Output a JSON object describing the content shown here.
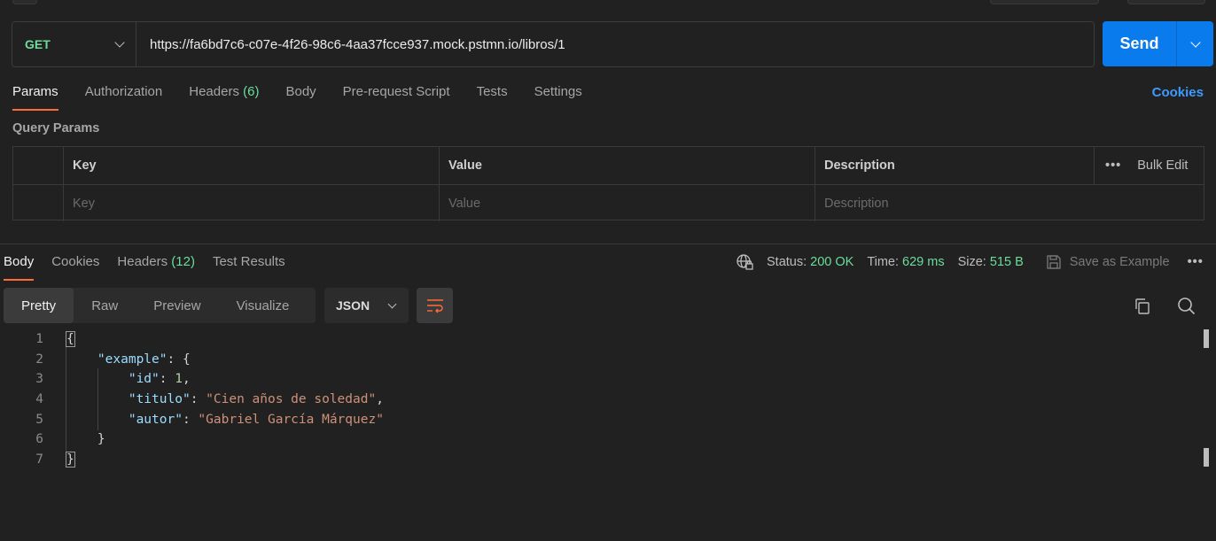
{
  "request": {
    "method": "GET",
    "url": "https://fa6bd7c6-c07e-4f26-98c6-4aa37fcce937.mock.pstmn.io/libros/1",
    "send_label": "Send"
  },
  "request_tabs": {
    "params": "Params",
    "authorization": "Authorization",
    "headers": "Headers",
    "headers_count": "(6)",
    "body": "Body",
    "prerequest": "Pre-request Script",
    "tests": "Tests",
    "settings": "Settings",
    "cookies": "Cookies"
  },
  "query_params": {
    "title": "Query Params",
    "col_key": "Key",
    "col_value": "Value",
    "col_description": "Description",
    "bulk_edit": "Bulk Edit",
    "more": "•••",
    "placeholder_key": "Key",
    "placeholder_value": "Value",
    "placeholder_description": "Description"
  },
  "response_tabs": {
    "body": "Body",
    "cookies": "Cookies",
    "headers": "Headers",
    "headers_count": "(12)",
    "test_results": "Test Results"
  },
  "response_status": {
    "status_label": "Status:",
    "status_value": "200 OK",
    "time_label": "Time:",
    "time_value": "629 ms",
    "size_label": "Size:",
    "size_value": "515 B",
    "save_example": "Save as Example",
    "more": "•••"
  },
  "view_modes": {
    "pretty": "Pretty",
    "raw": "Raw",
    "preview": "Preview",
    "visualize": "Visualize",
    "format": "JSON"
  },
  "code": {
    "line_numbers": [
      "1",
      "2",
      "3",
      "4",
      "5",
      "6",
      "7"
    ],
    "open_brace": "{",
    "example_key": "\"example\"",
    "colon": ": ",
    "inner_open": "{",
    "id_key": "\"id\"",
    "id_value": "1",
    "titulo_key": "\"titulo\"",
    "titulo_value": "\"Cien años de soledad\"",
    "autor_key": "\"autor\"",
    "autor_value": "\"Gabriel García Márquez\"",
    "comma": ",",
    "inner_close": "}",
    "close_brace": "}"
  },
  "colors": {
    "accent": "#ff6c37",
    "send": "#097bed",
    "success": "#6bdd9a",
    "link": "#3d9bff"
  }
}
